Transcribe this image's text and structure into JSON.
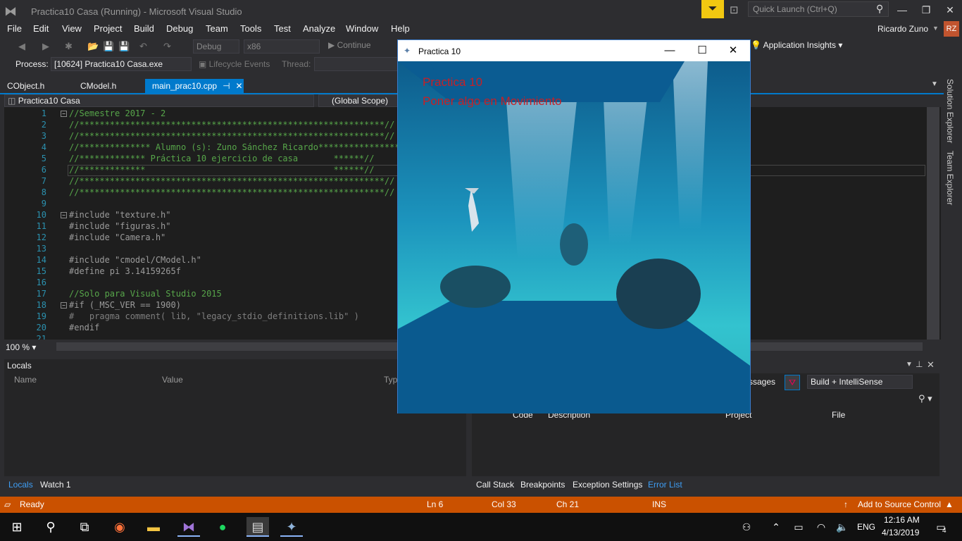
{
  "window": {
    "title": "Practica10 Casa (Running) - Microsoft Visual Studio"
  },
  "quick_launch": {
    "placeholder": "Quick Launch (Ctrl+Q)"
  },
  "menu": [
    "File",
    "Edit",
    "View",
    "Project",
    "Build",
    "Debug",
    "Team",
    "Tools",
    "Test",
    "Analyze",
    "Window",
    "Help"
  ],
  "account": {
    "name": "Ricardo Zuno",
    "initials": "RZ"
  },
  "toolbar": {
    "config": "Debug",
    "platform": "x86",
    "continue": "Continue",
    "app_insights": "Application Insights"
  },
  "debug_bar": {
    "process_label": "Process:",
    "process_value": "[10624] Practica10 Casa.exe",
    "lifecycle": "Lifecycle Events",
    "thread_label": "Thread:"
  },
  "tabs": [
    {
      "label": "CObject.h"
    },
    {
      "label": "CModel.h"
    },
    {
      "label": "main_prac10.cpp"
    }
  ],
  "nav": {
    "project": "Practica10 Casa",
    "scope": "(Global Scope)"
  },
  "editor": {
    "zoom": "100 %",
    "line_numbers": [
      "1",
      "2",
      "3",
      "4",
      "5",
      "6",
      "7",
      "8",
      "9",
      "10",
      "11",
      "12",
      "13",
      "14",
      "15",
      "16",
      "17",
      "18",
      "19",
      "20",
      "21"
    ],
    "lines": [
      "//Semestre 2017 - 2",
      "//************************************************************//",
      "//************************************************************//",
      "//************** Alumno (s): Zuno Sánchez Ricardo****************",
      "//************* Práctica 10 ejercicio de casa       ******//",
      "//*************                                     ******//",
      "//************************************************************//",
      "//************************************************************//",
      "",
      "#include \"texture.h\"",
      "#include \"figuras.h\"",
      "#include \"Camera.h\"",
      "",
      "#include \"cmodel/CModel.h\"",
      "#define pi 3.14159265f",
      "",
      "//Solo para Visual Studio 2015",
      "#if (_MSC_VER == 1900)",
      "#   pragma comment( lib, \"legacy_stdio_definitions.lib\" )",
      "#endif",
      ""
    ]
  },
  "locals": {
    "title": "Locals",
    "col_name": "Name",
    "col_value": "Value",
    "col_type": "Typ"
  },
  "bottom_left_tabs": [
    "Locals",
    "Watch 1"
  ],
  "error_list": {
    "messages": "ssages",
    "scope": "Build + IntelliSense",
    "cols": [
      "Code",
      "Description",
      "Project",
      "File"
    ]
  },
  "bottom_right_tabs": [
    "Call Stack",
    "Breakpoints",
    "Exception Settings",
    "Error List"
  ],
  "side_tabs": [
    "Solution Explorer",
    "Team Explorer"
  ],
  "status": {
    "state": "Ready",
    "ln": "Ln 6",
    "col": "Col 33",
    "ch": "Ch 21",
    "ins": "INS",
    "source_control": "Add to Source Control"
  },
  "taskbar": {
    "lang": "ENG",
    "time": "12:16 AM",
    "date": "4/13/2019",
    "notifications": "4"
  },
  "gl_window": {
    "title": "Practica 10",
    "line1": "Practica 10",
    "line2": "Poner algo en Movimiento"
  },
  "colors": {
    "accent": "#007acc",
    "status_bar": "#ca5100",
    "gl_text": "#c62026"
  }
}
